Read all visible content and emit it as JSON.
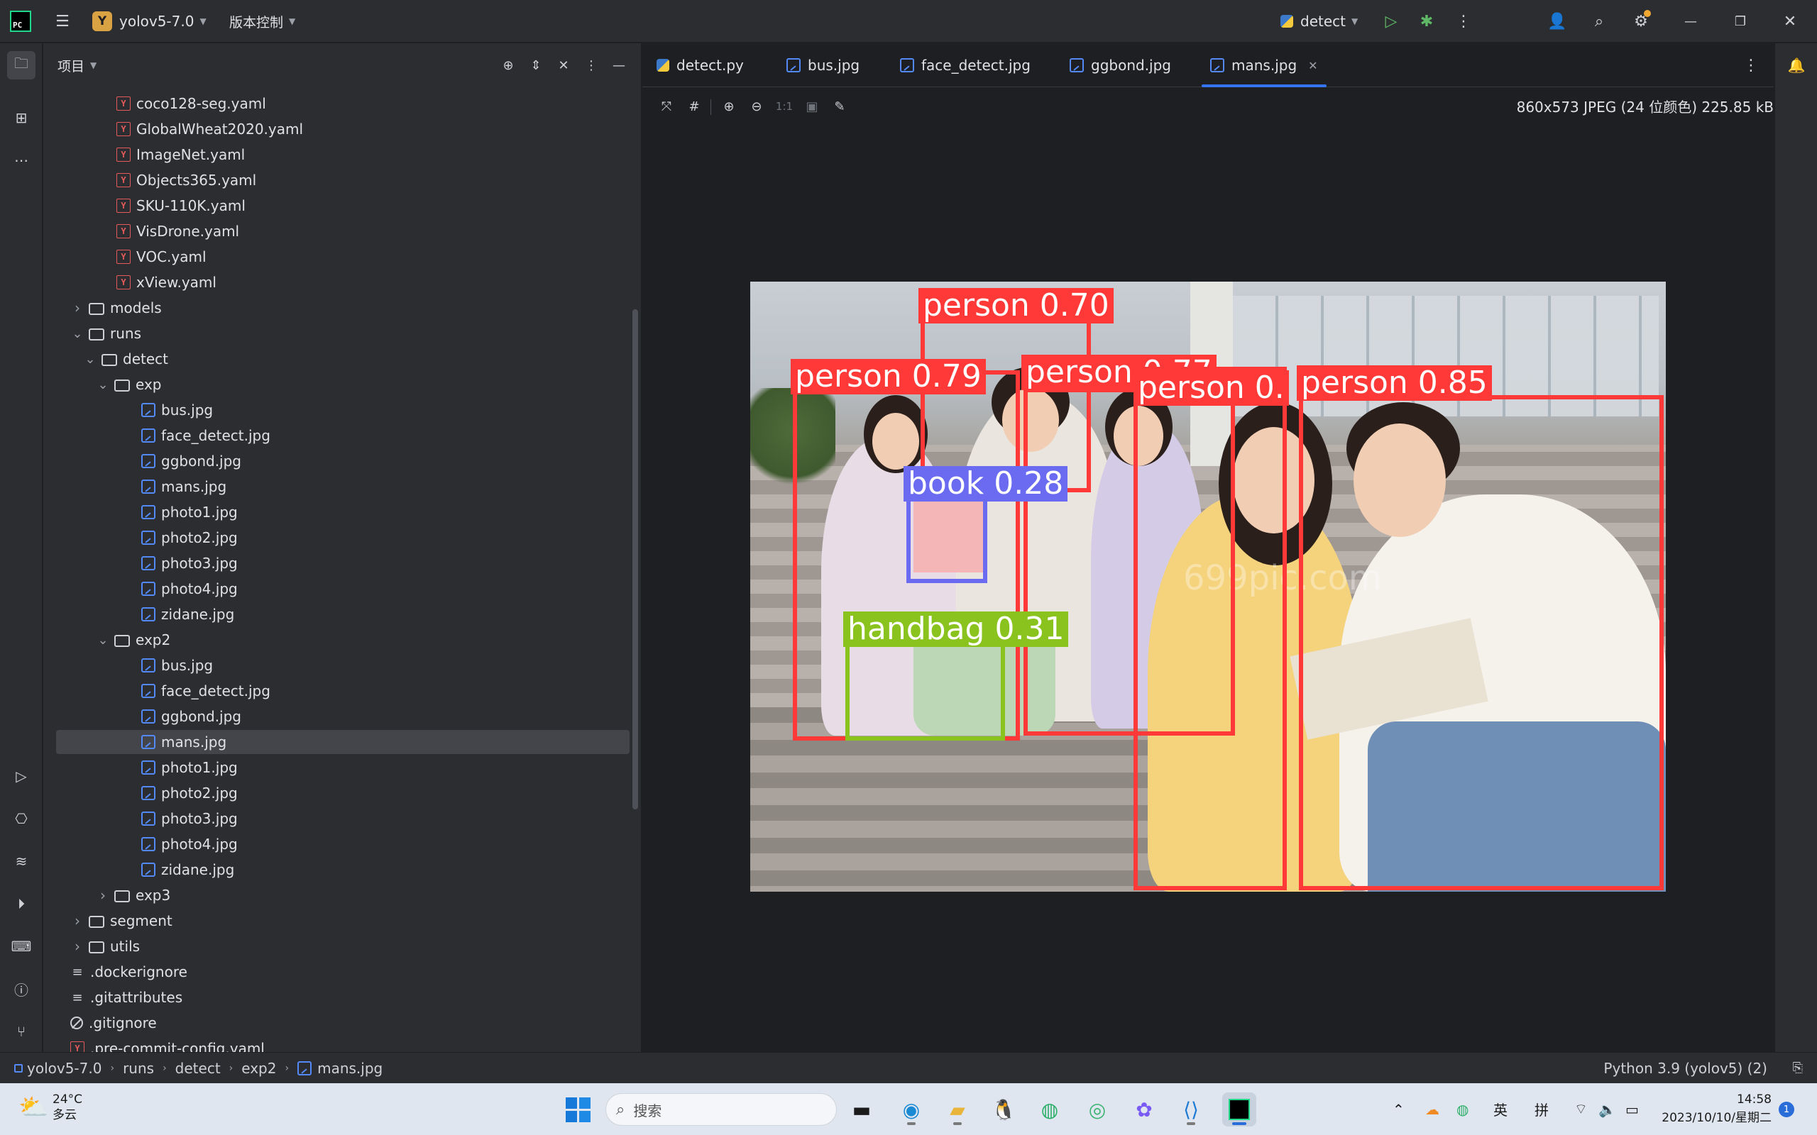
{
  "titlebar": {
    "logo_text": "PC",
    "project_badge": "Y",
    "project_name": "yolov5-7.0",
    "vcs_label": "版本控制",
    "run_config": "detect"
  },
  "project_panel": {
    "title": "项目",
    "tree": [
      {
        "label": "coco128-seg.yaml",
        "type": "yaml",
        "depth": 3
      },
      {
        "label": "GlobalWheat2020.yaml",
        "type": "yaml",
        "depth": 3
      },
      {
        "label": "ImageNet.yaml",
        "type": "yaml",
        "depth": 3
      },
      {
        "label": "Objects365.yaml",
        "type": "yaml",
        "depth": 3
      },
      {
        "label": "SKU-110K.yaml",
        "type": "yaml",
        "depth": 3
      },
      {
        "label": "VisDrone.yaml",
        "type": "yaml",
        "depth": 3
      },
      {
        "label": "VOC.yaml",
        "type": "yaml",
        "depth": 3
      },
      {
        "label": "xView.yaml",
        "type": "yaml",
        "depth": 3
      },
      {
        "label": "models",
        "type": "folder",
        "depth": 1,
        "arrow": "collapsed"
      },
      {
        "label": "runs",
        "type": "folder",
        "depth": 1,
        "arrow": "expanded"
      },
      {
        "label": "detect",
        "type": "folder",
        "depth": 2,
        "arrow": "expanded"
      },
      {
        "label": "exp",
        "type": "folder",
        "depth": 3,
        "arrow": "expanded"
      },
      {
        "label": "bus.jpg",
        "type": "image",
        "depth": 4
      },
      {
        "label": "face_detect.jpg",
        "type": "image",
        "depth": 4
      },
      {
        "label": "ggbond.jpg",
        "type": "image",
        "depth": 4
      },
      {
        "label": "mans.jpg",
        "type": "image",
        "depth": 4
      },
      {
        "label": "photo1.jpg",
        "type": "image",
        "depth": 4
      },
      {
        "label": "photo2.jpg",
        "type": "image",
        "depth": 4
      },
      {
        "label": "photo3.jpg",
        "type": "image",
        "depth": 4
      },
      {
        "label": "photo4.jpg",
        "type": "image",
        "depth": 4
      },
      {
        "label": "zidane.jpg",
        "type": "image",
        "depth": 4
      },
      {
        "label": "exp2",
        "type": "folder",
        "depth": 3,
        "arrow": "expanded"
      },
      {
        "label": "bus.jpg",
        "type": "image",
        "depth": 4
      },
      {
        "label": "face_detect.jpg",
        "type": "image",
        "depth": 4
      },
      {
        "label": "ggbond.jpg",
        "type": "image",
        "depth": 4
      },
      {
        "label": "mans.jpg",
        "type": "image",
        "depth": 4,
        "selected": true
      },
      {
        "label": "photo1.jpg",
        "type": "image",
        "depth": 4
      },
      {
        "label": "photo2.jpg",
        "type": "image",
        "depth": 4
      },
      {
        "label": "photo3.jpg",
        "type": "image",
        "depth": 4
      },
      {
        "label": "photo4.jpg",
        "type": "image",
        "depth": 4
      },
      {
        "label": "zidane.jpg",
        "type": "image",
        "depth": 4
      },
      {
        "label": "exp3",
        "type": "folder",
        "depth": 3,
        "arrow": "collapsed"
      },
      {
        "label": "segment",
        "type": "folder",
        "depth": 1,
        "arrow": "collapsed"
      },
      {
        "label": "utils",
        "type": "folder",
        "depth": 1,
        "arrow": "collapsed"
      },
      {
        "label": ".dockerignore",
        "type": "lines",
        "depth": 1
      },
      {
        "label": ".gitattributes",
        "type": "lines",
        "depth": 1
      },
      {
        "label": ".gitignore",
        "type": "ignore",
        "depth": 1
      },
      {
        "label": ".pre-commit-config.yaml",
        "type": "yaml",
        "depth": 1
      }
    ]
  },
  "editor": {
    "tabs": [
      {
        "label": "detect.py",
        "icon": "python-icon"
      },
      {
        "label": "bus.jpg",
        "icon": "image-icon"
      },
      {
        "label": "face_detect.jpg",
        "icon": "image-icon"
      },
      {
        "label": "ggbond.jpg",
        "icon": "image-icon"
      },
      {
        "label": "mans.jpg",
        "icon": "image-icon",
        "active": true
      }
    ],
    "image_toolbar": {
      "actual_size_label": "1:1"
    },
    "image_info": "860x573 JPEG (24 位颜色) 225.85 kB",
    "detections": [
      {
        "label": "person 0.70",
        "color": "#ff3838"
      },
      {
        "label": "person 0.79",
        "color": "#ff3838"
      },
      {
        "label": "person 0.77",
        "color": "#ff3838"
      },
      {
        "label": "person 0.",
        "color": "#ff3838"
      },
      {
        "label": "person 0.85",
        "color": "#ff3838"
      },
      {
        "label": "book 0.28",
        "color": "#6a6bf0"
      },
      {
        "label": "handbag 0.31",
        "color": "#8ac31e"
      }
    ],
    "watermark": "699pic.com"
  },
  "statusbar": {
    "breadcrumb": [
      "yolov5-7.0",
      "runs",
      "detect",
      "exp2",
      "mans.jpg"
    ],
    "interpreter": "Python 3.9 (yolov5) (2)"
  },
  "taskbar": {
    "weather_temp": "24°C",
    "weather_desc": "多云",
    "search_placeholder": "搜索",
    "ime_lang": "英",
    "ime_mode": "拼",
    "time": "14:58",
    "date": "2023/10/10/星期二",
    "notification_count": "1"
  }
}
